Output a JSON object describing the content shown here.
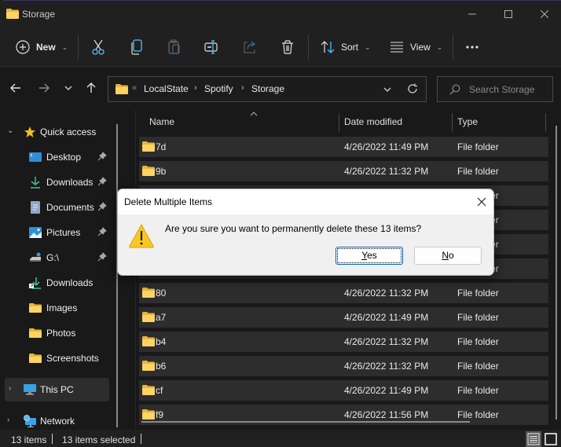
{
  "window": {
    "title": "Storage",
    "controls": {
      "minimize": "minimize",
      "maximize": "maximize",
      "close": "close"
    }
  },
  "toolbar": {
    "new_label": "New",
    "sort_label": "Sort",
    "view_label": "View",
    "icons": [
      "plus-circle-icon",
      "cut-icon",
      "copy-icon",
      "paste-icon",
      "rename-icon",
      "share-icon",
      "delete-icon",
      "sort-icon",
      "view-icon",
      "more-icon"
    ]
  },
  "address": {
    "overflow": "«",
    "crumbs": [
      "LocalState",
      "Spotify",
      "Storage"
    ],
    "separator": "›"
  },
  "search": {
    "placeholder": "Search Storage"
  },
  "sidebar": {
    "quick_access": "Quick access",
    "items": [
      {
        "label": "Desktop",
        "icon": "desktop-icon",
        "pinned": true
      },
      {
        "label": "Downloads",
        "icon": "download-icon",
        "pinned": true
      },
      {
        "label": "Documents",
        "icon": "documents-icon",
        "pinned": true
      },
      {
        "label": "Pictures",
        "icon": "pictures-icon",
        "pinned": true
      },
      {
        "label": "G:\\",
        "icon": "drive-icon",
        "pinned": true
      },
      {
        "label": "Downloads",
        "icon": "download-shortcut-icon",
        "pinned": false
      },
      {
        "label": "Images",
        "icon": "folder-icon",
        "pinned": false
      },
      {
        "label": "Photos",
        "icon": "folder-icon",
        "pinned": false
      },
      {
        "label": "Screenshots",
        "icon": "folder-icon",
        "pinned": false
      }
    ],
    "this_pc": "This PC",
    "network": "Network"
  },
  "list": {
    "columns": {
      "name": "Name",
      "date": "Date modified",
      "type": "Type"
    },
    "rows": [
      {
        "name": "7d",
        "date": "4/26/2022 11:49 PM",
        "type": "File folder"
      },
      {
        "name": "9b",
        "date": "4/26/2022 11:32 PM",
        "type": "File folder"
      },
      {
        "name": "",
        "date": "",
        "type": "File folder"
      },
      {
        "name": "",
        "date": "",
        "type": "File folder"
      },
      {
        "name": "",
        "date": "",
        "type": "File folder"
      },
      {
        "name": "",
        "date": "",
        "type": "File folder"
      },
      {
        "name": "80",
        "date": "4/26/2022 11:32 PM",
        "type": "File folder"
      },
      {
        "name": "a7",
        "date": "4/26/2022 11:49 PM",
        "type": "File folder"
      },
      {
        "name": "b4",
        "date": "4/26/2022 11:32 PM",
        "type": "File folder"
      },
      {
        "name": "b6",
        "date": "4/26/2022 11:32 PM",
        "type": "File folder"
      },
      {
        "name": "cf",
        "date": "4/26/2022 11:49 PM",
        "type": "File folder"
      },
      {
        "name": "f9",
        "date": "4/26/2022 11:56 PM",
        "type": "File folder"
      }
    ]
  },
  "status": {
    "item_count": "13 items",
    "selected_count": "13 items selected"
  },
  "dialog": {
    "title": "Delete Multiple Items",
    "message": "Are you sure you want to permanently delete these 13 items?",
    "yes_label": "Yes",
    "no_label": "No",
    "yes_mnemonic": "Y",
    "no_mnemonic": "N"
  },
  "colors": {
    "folder": "#f0c040",
    "accent": "#4cc2ff",
    "dialog_bg": "#f0f0f0",
    "row_bg": "#2d2d2d"
  }
}
